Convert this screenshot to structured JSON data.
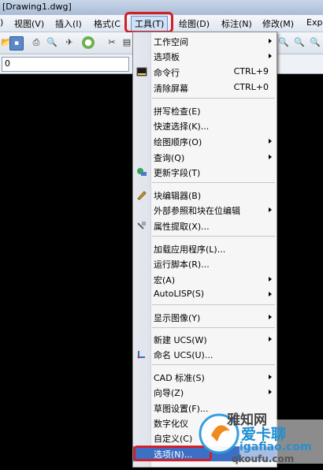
{
  "window": {
    "title": "[Drawing1.dwg]"
  },
  "menubar": {
    "items": [
      {
        "label": ")"
      },
      {
        "label": "视图(V)"
      },
      {
        "label": "插入(I)"
      },
      {
        "label": "格式(C"
      },
      {
        "label": "工具(T)"
      },
      {
        "label": "绘图(D)"
      },
      {
        "label": "标注(N)"
      },
      {
        "label": "修改(M)"
      },
      {
        "label": "Exp"
      }
    ]
  },
  "toolbar2": {
    "layer_value": "0"
  },
  "menu": {
    "items": [
      {
        "label": "工作空间",
        "submenu": true
      },
      {
        "label": "选项板",
        "submenu": true
      },
      {
        "label": "命令行",
        "shortcut": "CTRL+9",
        "icon": "command-line-icon"
      },
      {
        "label": "清除屏幕",
        "shortcut": "CTRL+0"
      },
      {
        "sep": true
      },
      {
        "label": "拼写检查(E)"
      },
      {
        "label": "快速选择(K)..."
      },
      {
        "label": "绘图顺序(O)",
        "submenu": true
      },
      {
        "label": "查询(Q)",
        "submenu": true
      },
      {
        "label": "更新字段(T)",
        "icon": "update-field-icon"
      },
      {
        "sep": true
      },
      {
        "label": "块编辑器(B)",
        "icon": "block-editor-icon"
      },
      {
        "label": "外部参照和块在位编辑",
        "submenu": true
      },
      {
        "label": "属性提取(X)...",
        "icon": "attribute-extract-icon"
      },
      {
        "sep": true
      },
      {
        "label": "加载应用程序(L)..."
      },
      {
        "label": "运行脚本(R)..."
      },
      {
        "label": "宏(A)",
        "submenu": true
      },
      {
        "label": "AutoLISP(S)",
        "submenu": true
      },
      {
        "sep": true
      },
      {
        "label": "显示图像(Y)",
        "submenu": true
      },
      {
        "sep": true
      },
      {
        "label": "新建 UCS(W)",
        "submenu": true
      },
      {
        "label": "命名 UCS(U)...",
        "icon": "named-ucs-icon"
      },
      {
        "sep": true
      },
      {
        "label": "CAD 标准(S)",
        "submenu": true
      },
      {
        "label": "向导(Z)",
        "submenu": true
      },
      {
        "label": "草图设置(F)..."
      },
      {
        "label": "数字化仪"
      },
      {
        "label": "自定义(C)"
      },
      {
        "label": "选项(N)...",
        "selected": true
      }
    ]
  },
  "watermark": {
    "line1": "雅知网",
    "line2": "爱卡聊",
    "line3": "igafiao.com",
    "line4": "qkoufu.com"
  },
  "colors": {
    "highlight": "#d0202a",
    "selection": "#3d6fc4"
  }
}
